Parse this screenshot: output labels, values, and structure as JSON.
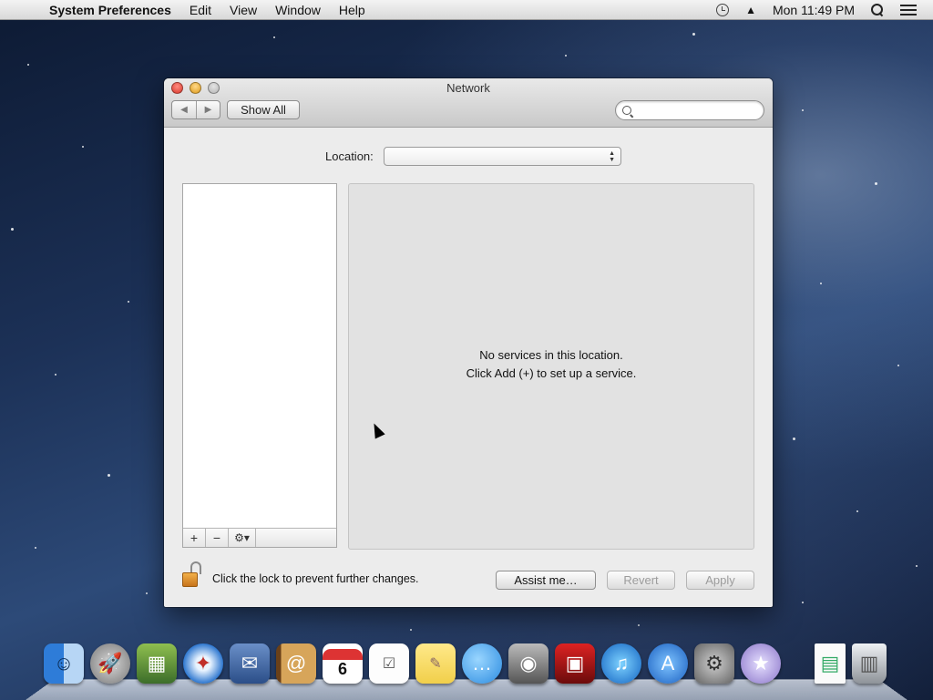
{
  "menubar": {
    "app_name": "System Preferences",
    "items": [
      "Edit",
      "View",
      "Window",
      "Help"
    ],
    "clock": "Mon 11:49 PM"
  },
  "window": {
    "title": "Network",
    "show_all_label": "Show All",
    "search_placeholder": "",
    "location_label": "Location:",
    "location_value": "",
    "empty_message_line1": "No services in this location.",
    "empty_message_line2": "Click Add (+) to set up a service.",
    "lock_text": "Click the lock to prevent further changes.",
    "buttons": {
      "assist": "Assist me…",
      "revert": "Revert",
      "apply": "Apply"
    },
    "list_footer": {
      "add": "+",
      "remove": "−",
      "gear": "⚙▾"
    }
  },
  "dock": {
    "icons": [
      "finder-icon",
      "launchpad-icon",
      "mission-control-icon",
      "safari-icon",
      "mail-icon",
      "contacts-icon",
      "calendar-icon",
      "reminders-icon",
      "notes-icon",
      "messages-icon",
      "facetime-icon",
      "photo-booth-icon",
      "itunes-icon",
      "app-store-icon",
      "system-preferences-icon",
      "wizard-icon",
      "document-icon",
      "trash-icon"
    ],
    "calendar_day": "6"
  }
}
